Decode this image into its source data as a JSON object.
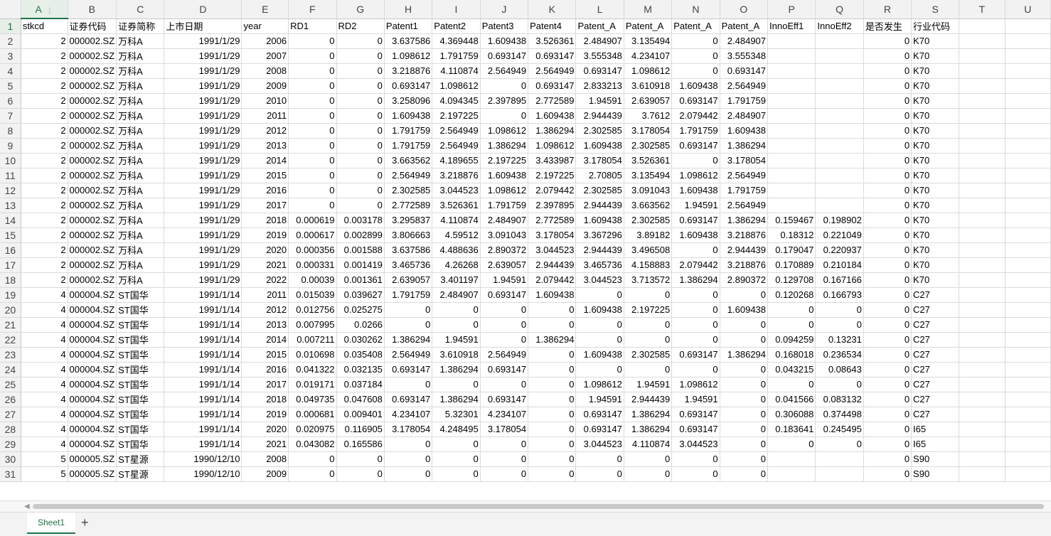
{
  "columns": [
    "A",
    "B",
    "C",
    "D",
    "E",
    "F",
    "G",
    "H",
    "I",
    "J",
    "K",
    "L",
    "M",
    "N",
    "O",
    "P",
    "Q",
    "R",
    "S",
    "T",
    "U"
  ],
  "header_row": [
    "stkcd",
    "证券代码",
    "证券简称",
    "上市日期",
    "year",
    "RD1",
    "RD2",
    "Patent1",
    "Patent2",
    "Patent3",
    "Patent4",
    "Patent_A",
    "Patent_A",
    "Patent_A",
    "Patent_A",
    "InnoEff1",
    "InnoEff2",
    "是否发生",
    "行业代码",
    "",
    ""
  ],
  "rows": [
    [
      "2",
      "000002.SZ",
      "万科A",
      "1991/1/29",
      "2006",
      "0",
      "0",
      "3.637586",
      "4.369448",
      "1.609438",
      "3.526361",
      "2.484907",
      "3.135494",
      "0",
      "2.484907",
      "",
      "",
      "0",
      "K70"
    ],
    [
      "2",
      "000002.SZ",
      "万科A",
      "1991/1/29",
      "2007",
      "0",
      "0",
      "1.098612",
      "1.791759",
      "0.693147",
      "0.693147",
      "3.555348",
      "4.234107",
      "0",
      "3.555348",
      "",
      "",
      "0",
      "K70"
    ],
    [
      "2",
      "000002.SZ",
      "万科A",
      "1991/1/29",
      "2008",
      "0",
      "0",
      "3.218876",
      "4.110874",
      "2.564949",
      "2.564949",
      "0.693147",
      "1.098612",
      "0",
      "0.693147",
      "",
      "",
      "0",
      "K70"
    ],
    [
      "2",
      "000002.SZ",
      "万科A",
      "1991/1/29",
      "2009",
      "0",
      "0",
      "0.693147",
      "1.098612",
      "0",
      "0.693147",
      "2.833213",
      "3.610918",
      "1.609438",
      "2.564949",
      "",
      "",
      "0",
      "K70"
    ],
    [
      "2",
      "000002.SZ",
      "万科A",
      "1991/1/29",
      "2010",
      "0",
      "0",
      "3.258096",
      "4.094345",
      "2.397895",
      "2.772589",
      "1.94591",
      "2.639057",
      "0.693147",
      "1.791759",
      "",
      "",
      "0",
      "K70"
    ],
    [
      "2",
      "000002.SZ",
      "万科A",
      "1991/1/29",
      "2011",
      "0",
      "0",
      "1.609438",
      "2.197225",
      "0",
      "1.609438",
      "2.944439",
      "3.7612",
      "2.079442",
      "2.484907",
      "",
      "",
      "0",
      "K70"
    ],
    [
      "2",
      "000002.SZ",
      "万科A",
      "1991/1/29",
      "2012",
      "0",
      "0",
      "1.791759",
      "2.564949",
      "1.098612",
      "1.386294",
      "2.302585",
      "3.178054",
      "1.791759",
      "1.609438",
      "",
      "",
      "0",
      "K70"
    ],
    [
      "2",
      "000002.SZ",
      "万科A",
      "1991/1/29",
      "2013",
      "0",
      "0",
      "1.791759",
      "2.564949",
      "1.386294",
      "1.098612",
      "1.609438",
      "2.302585",
      "0.693147",
      "1.386294",
      "",
      "",
      "0",
      "K70"
    ],
    [
      "2",
      "000002.SZ",
      "万科A",
      "1991/1/29",
      "2014",
      "0",
      "0",
      "3.663562",
      "4.189655",
      "2.197225",
      "3.433987",
      "3.178054",
      "3.526361",
      "0",
      "3.178054",
      "",
      "",
      "0",
      "K70"
    ],
    [
      "2",
      "000002.SZ",
      "万科A",
      "1991/1/29",
      "2015",
      "0",
      "0",
      "2.564949",
      "3.218876",
      "1.609438",
      "2.197225",
      "2.70805",
      "3.135494",
      "1.098612",
      "2.564949",
      "",
      "",
      "0",
      "K70"
    ],
    [
      "2",
      "000002.SZ",
      "万科A",
      "1991/1/29",
      "2016",
      "0",
      "0",
      "2.302585",
      "3.044523",
      "1.098612",
      "2.079442",
      "2.302585",
      "3.091043",
      "1.609438",
      "1.791759",
      "",
      "",
      "0",
      "K70"
    ],
    [
      "2",
      "000002.SZ",
      "万科A",
      "1991/1/29",
      "2017",
      "0",
      "0",
      "2.772589",
      "3.526361",
      "1.791759",
      "2.397895",
      "2.944439",
      "3.663562",
      "1.94591",
      "2.564949",
      "",
      "",
      "0",
      "K70"
    ],
    [
      "2",
      "000002.SZ",
      "万科A",
      "1991/1/29",
      "2018",
      "0.000619",
      "0.003178",
      "3.295837",
      "4.110874",
      "2.484907",
      "2.772589",
      "1.609438",
      "2.302585",
      "0.693147",
      "1.386294",
      "0.159467",
      "0.198902",
      "0",
      "K70"
    ],
    [
      "2",
      "000002.SZ",
      "万科A",
      "1991/1/29",
      "2019",
      "0.000617",
      "0.002899",
      "3.806663",
      "4.59512",
      "3.091043",
      "3.178054",
      "3.367296",
      "3.89182",
      "1.609438",
      "3.218876",
      "0.18312",
      "0.221049",
      "0",
      "K70"
    ],
    [
      "2",
      "000002.SZ",
      "万科A",
      "1991/1/29",
      "2020",
      "0.000356",
      "0.001588",
      "3.637586",
      "4.488636",
      "2.890372",
      "3.044523",
      "2.944439",
      "3.496508",
      "0",
      "2.944439",
      "0.179047",
      "0.220937",
      "0",
      "K70"
    ],
    [
      "2",
      "000002.SZ",
      "万科A",
      "1991/1/29",
      "2021",
      "0.000331",
      "0.001419",
      "3.465736",
      "4.26268",
      "2.639057",
      "2.944439",
      "3.465736",
      "4.158883",
      "2.079442",
      "3.218876",
      "0.170889",
      "0.210184",
      "0",
      "K70"
    ],
    [
      "2",
      "000002.SZ",
      "万科A",
      "1991/1/29",
      "2022",
      "0.00039",
      "0.001361",
      "2.639057",
      "3.401197",
      "1.94591",
      "2.079442",
      "3.044523",
      "3.713572",
      "1.386294",
      "2.890372",
      "0.129708",
      "0.167166",
      "0",
      "K70"
    ],
    [
      "4",
      "000004.SZ",
      "ST国华",
      "1991/1/14",
      "2011",
      "0.015039",
      "0.039627",
      "1.791759",
      "2.484907",
      "0.693147",
      "1.609438",
      "0",
      "0",
      "0",
      "0",
      "0.120268",
      "0.166793",
      "0",
      "C27"
    ],
    [
      "4",
      "000004.SZ",
      "ST国华",
      "1991/1/14",
      "2012",
      "0.012756",
      "0.025275",
      "0",
      "0",
      "0",
      "0",
      "1.609438",
      "2.197225",
      "0",
      "1.609438",
      "0",
      "0",
      "0",
      "C27"
    ],
    [
      "4",
      "000004.SZ",
      "ST国华",
      "1991/1/14",
      "2013",
      "0.007995",
      "0.0266",
      "0",
      "0",
      "0",
      "0",
      "0",
      "0",
      "0",
      "0",
      "0",
      "0",
      "0",
      "C27"
    ],
    [
      "4",
      "000004.SZ",
      "ST国华",
      "1991/1/14",
      "2014",
      "0.007211",
      "0.030262",
      "1.386294",
      "1.94591",
      "0",
      "1.386294",
      "0",
      "0",
      "0",
      "0",
      "0.094259",
      "0.13231",
      "0",
      "C27"
    ],
    [
      "4",
      "000004.SZ",
      "ST国华",
      "1991/1/14",
      "2015",
      "0.010698",
      "0.035408",
      "2.564949",
      "3.610918",
      "2.564949",
      "0",
      "1.609438",
      "2.302585",
      "0.693147",
      "1.386294",
      "0.168018",
      "0.236534",
      "0",
      "C27"
    ],
    [
      "4",
      "000004.SZ",
      "ST国华",
      "1991/1/14",
      "2016",
      "0.041322",
      "0.032135",
      "0.693147",
      "1.386294",
      "0.693147",
      "0",
      "0",
      "0",
      "0",
      "0",
      "0.043215",
      "0.08643",
      "0",
      "C27"
    ],
    [
      "4",
      "000004.SZ",
      "ST国华",
      "1991/1/14",
      "2017",
      "0.019171",
      "0.037184",
      "0",
      "0",
      "0",
      "0",
      "1.098612",
      "1.94591",
      "1.098612",
      "0",
      "0",
      "0",
      "0",
      "C27"
    ],
    [
      "4",
      "000004.SZ",
      "ST国华",
      "1991/1/14",
      "2018",
      "0.049735",
      "0.047608",
      "0.693147",
      "1.386294",
      "0.693147",
      "0",
      "1.94591",
      "2.944439",
      "1.94591",
      "0",
      "0.041566",
      "0.083132",
      "0",
      "C27"
    ],
    [
      "4",
      "000004.SZ",
      "ST国华",
      "1991/1/14",
      "2019",
      "0.000681",
      "0.009401",
      "4.234107",
      "5.32301",
      "4.234107",
      "0",
      "0.693147",
      "1.386294",
      "0.693147",
      "0",
      "0.306088",
      "0.374498",
      "0",
      "C27"
    ],
    [
      "4",
      "000004.SZ",
      "ST国华",
      "1991/1/14",
      "2020",
      "0.020975",
      "0.116905",
      "3.178054",
      "4.248495",
      "3.178054",
      "0",
      "0.693147",
      "1.386294",
      "0.693147",
      "0",
      "0.183641",
      "0.245495",
      "0",
      "I65"
    ],
    [
      "4",
      "000004.SZ",
      "ST国华",
      "1991/1/14",
      "2021",
      "0.043082",
      "0.165586",
      "0",
      "0",
      "0",
      "0",
      "3.044523",
      "4.110874",
      "3.044523",
      "0",
      "0",
      "0",
      "0",
      "I65"
    ],
    [
      "5",
      "000005.SZ",
      "ST星源",
      "1990/12/10",
      "2008",
      "0",
      "0",
      "0",
      "0",
      "0",
      "0",
      "0",
      "0",
      "0",
      "0",
      "",
      "",
      "0",
      "S90"
    ],
    [
      "5",
      "000005.SZ",
      "ST星源",
      "1990/12/10",
      "2009",
      "0",
      "0",
      "0",
      "0",
      "0",
      "0",
      "0",
      "0",
      "0",
      "0",
      "",
      "",
      "0",
      "S90"
    ]
  ],
  "sheet_tab": "Sheet1",
  "add_tab_label": "+",
  "col_menu_glyph": "⋮",
  "scroll_left_glyph": "◀",
  "accent_color": "#217346"
}
